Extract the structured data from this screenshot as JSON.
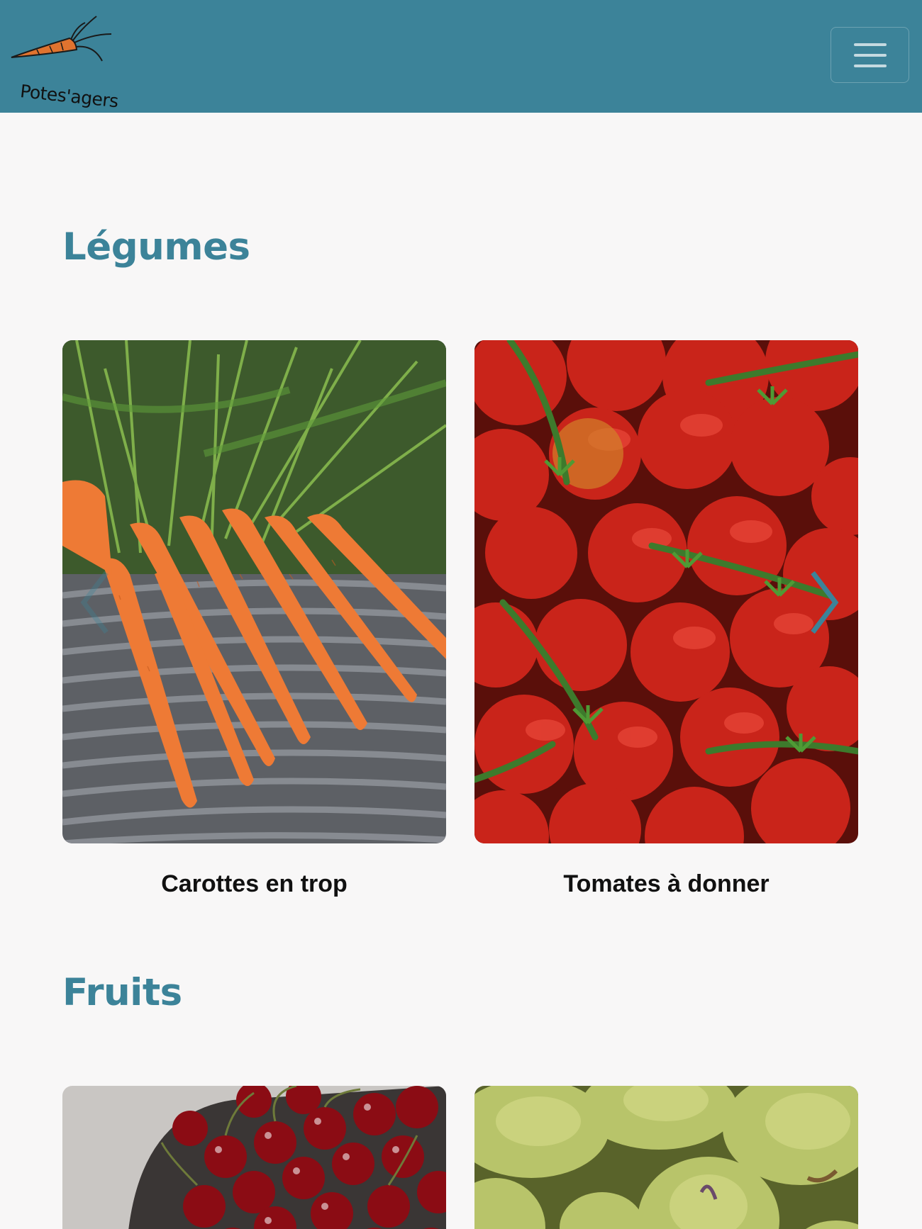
{
  "brand": {
    "name": "Potes'agers",
    "accent": "#3c8399",
    "carrot": "#e0732f"
  },
  "nav": {
    "menu_icon": "hamburger-icon"
  },
  "sections": [
    {
      "title": "Légumes",
      "items": [
        {
          "caption": "Carottes en trop",
          "image": "carrots-photo"
        },
        {
          "caption": "Tomates à donner",
          "image": "tomatoes-photo"
        }
      ],
      "controls": {
        "prev_icon": "chevron-left-icon",
        "next_icon": "chevron-right-icon"
      }
    },
    {
      "title": "Fruits",
      "items": [
        {
          "caption": "",
          "image": "cherries-photo"
        },
        {
          "caption": "",
          "image": "pears-photo"
        }
      ]
    }
  ]
}
